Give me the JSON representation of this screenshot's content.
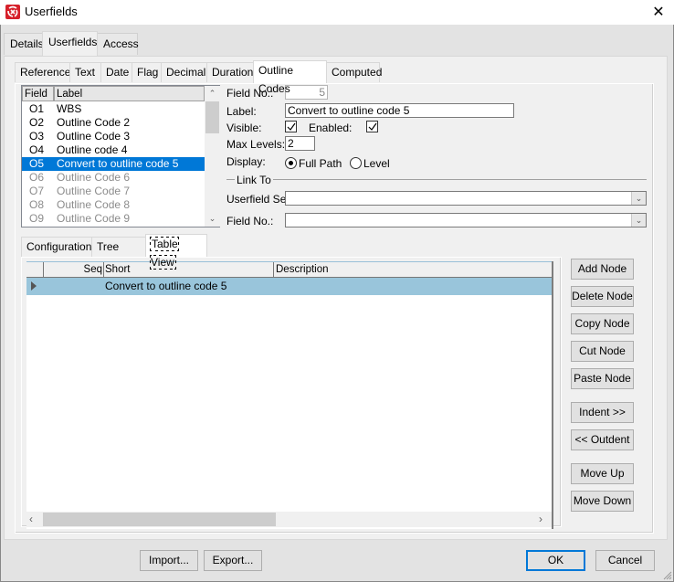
{
  "window": {
    "title": "Userfields",
    "close_glyph": "✕"
  },
  "main_tabs": [
    {
      "label": "Details",
      "active": false
    },
    {
      "label": "Userfields",
      "active": true
    },
    {
      "label": "Access",
      "active": false
    }
  ],
  "type_tabs": [
    {
      "label": "Reference",
      "active": false
    },
    {
      "label": "Text",
      "active": false
    },
    {
      "label": "Date",
      "active": false
    },
    {
      "label": "Flag",
      "active": false
    },
    {
      "label": "Decimal",
      "active": false
    },
    {
      "label": "Duration",
      "active": false
    },
    {
      "label": "Outline Codes",
      "active": true
    },
    {
      "label": "Computed",
      "active": false
    }
  ],
  "field_list": {
    "columns": [
      "Field",
      "Label"
    ],
    "rows": [
      {
        "field": "O1",
        "label": "WBS",
        "state": "enabled"
      },
      {
        "field": "O2",
        "label": "Outline Code 2",
        "state": "enabled"
      },
      {
        "field": "O3",
        "label": "Outline Code 3",
        "state": "enabled"
      },
      {
        "field": "O4",
        "label": "Outline code 4",
        "state": "enabled"
      },
      {
        "field": "O5",
        "label": "Convert to outline code 5",
        "state": "selected"
      },
      {
        "field": "O6",
        "label": "Outline Code 6",
        "state": "disabled"
      },
      {
        "field": "O7",
        "label": "Outline Code 7",
        "state": "disabled"
      },
      {
        "field": "O8",
        "label": "Outline Code 8",
        "state": "disabled"
      },
      {
        "field": "O9",
        "label": "Outline Code 9",
        "state": "disabled"
      }
    ]
  },
  "form": {
    "field_no_label": "Field No.:",
    "field_no_value": "5",
    "label_label": "Label:",
    "label_value": "Convert to outline code 5",
    "visible_label": "Visible:",
    "visible_checked": true,
    "enabled_label": "Enabled:",
    "enabled_checked": true,
    "max_levels_label": "Max Levels:",
    "max_levels_value": "2",
    "display_label": "Display:",
    "display_options": [
      {
        "label": "Full Path",
        "selected": true
      },
      {
        "label": "Level",
        "selected": false
      }
    ],
    "link_to_group": "Link To",
    "userfield_set_label": "Userfield Set:",
    "userfield_set_value": "",
    "link_field_no_label": "Field No.:",
    "link_field_no_value": ""
  },
  "view_tabs": [
    {
      "label": "Configuration",
      "active": false
    },
    {
      "label": "Tree View",
      "active": false
    },
    {
      "label": "Table View",
      "active": true
    }
  ],
  "grid": {
    "columns": [
      "Seq",
      "Short",
      "Description"
    ],
    "rows": [
      {
        "seq": "",
        "short": "Convert to outline code 5",
        "description": "",
        "selected": true
      }
    ]
  },
  "node_buttons": [
    "Add Node",
    "Delete Node",
    "Copy Node",
    "Cut Node",
    "Paste Node",
    "Indent >>",
    "<< Outdent",
    "Move Up",
    "Move Down"
  ],
  "footer": {
    "import_label": "Import...",
    "export_label": "Export...",
    "ok_label": "OK",
    "cancel_label": "Cancel"
  },
  "colors": {
    "selection": "#0078d7",
    "grid_selection": "#99c5db",
    "brand_icon": "#d6202a"
  }
}
